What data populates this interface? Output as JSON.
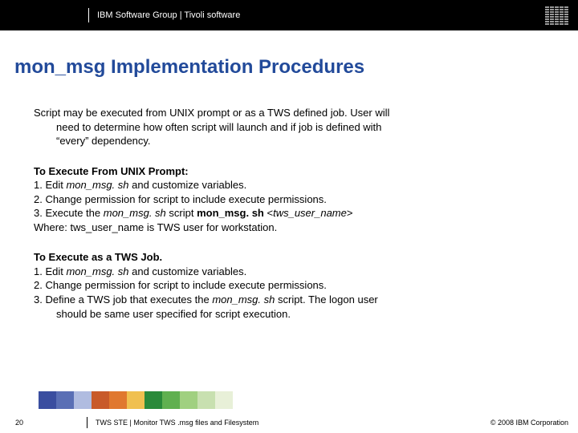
{
  "header": {
    "group": "IBM Software Group  |  Tivoli software"
  },
  "title": "mon_msg Implementation Procedures",
  "intro": {
    "line1": "Script may be executed from UNIX prompt or as a TWS defined job. User will",
    "line2": "need to determine how often script will launch and if job is defined with",
    "line3": "“every” dependency."
  },
  "unix": {
    "head": "To Execute From UNIX Prompt:",
    "s1a": "1. Edit ",
    "s1b": "mon_msg. sh",
    "s1c": " and customize variables.",
    "s2": "2. Change permission for script to include execute permissions.",
    "s3a": "3. Execute the ",
    "s3b": "mon_msg. sh",
    "s3c": " script ",
    "s3d": "mon_msg. sh",
    "s3e": " <",
    "s3f": "tws_user_name",
    "s3g": ">",
    "where": "Where: tws_user_name is TWS user for workstation."
  },
  "job": {
    "head": "To Execute as a TWS Job.",
    "s1a": "1. Edit ",
    "s1b": "mon_msg. sh",
    "s1c": " and customize variables.",
    "s2": "2. Change permission for script to include execute permissions.",
    "s3a": "3. Define a TWS job that executes the ",
    "s3b": "mon_msg. sh",
    "s3c": " script. The logon user",
    "s3cont": "should be same user specified for script execution."
  },
  "footer": {
    "page": "20",
    "title": "TWS STE | Monitor TWS .msg files and Filesystem",
    "copyright": "© 2008 IBM Corporation"
  },
  "band_colors": [
    "#3a4ea0",
    "#5a6fb5",
    "#b0bce0",
    "#c85a2a",
    "#e0782f",
    "#f0c050",
    "#2a8a3a",
    "#60b050",
    "#a0d080",
    "#c8e0b0",
    "#e8f0d8"
  ]
}
